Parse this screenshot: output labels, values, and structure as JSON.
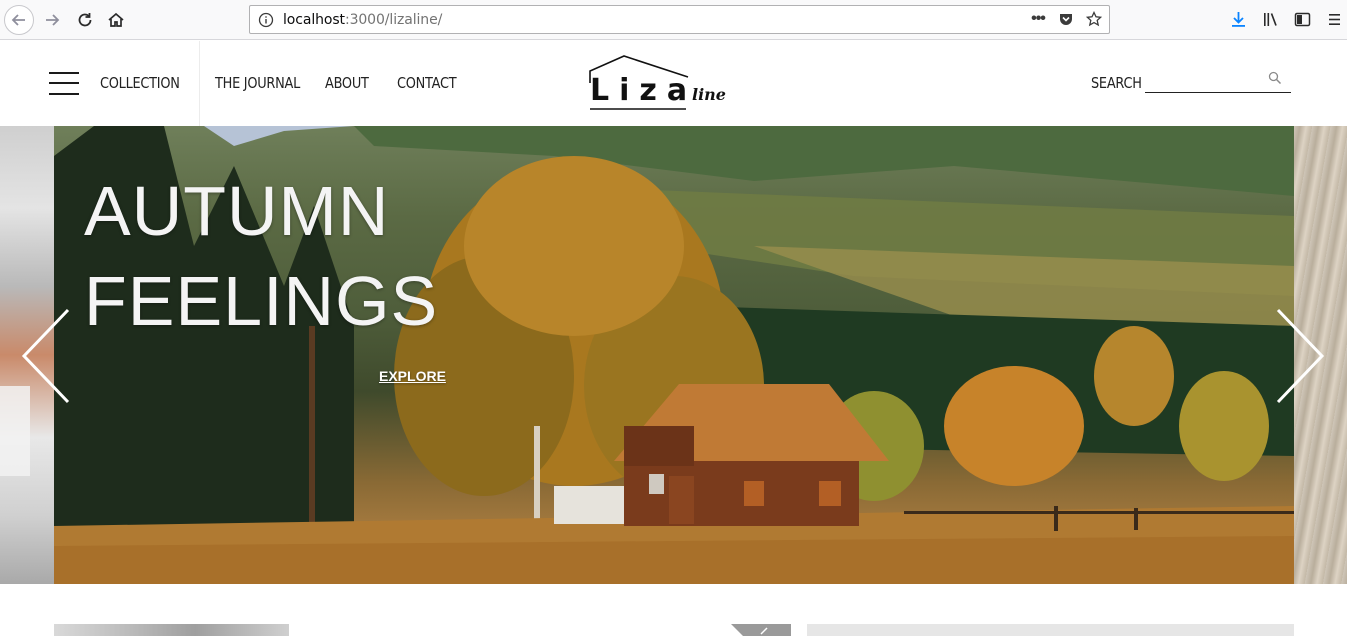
{
  "browser": {
    "url_host": "localhost",
    "url_rest": ":3000/lizaline/",
    "page_actions_label": "•••"
  },
  "header": {
    "nav": {
      "collection": "COLLECTION",
      "journal": "THE JOURNAL",
      "about": "ABOUT",
      "contact": "CONTACT"
    },
    "logo": {
      "main": "Liza",
      "sub": "line"
    },
    "search": {
      "label": "SEARCH",
      "value": "",
      "placeholder": ""
    }
  },
  "hero": {
    "title_line1": "AUTUMN",
    "title_line2": "FEELINGS",
    "cta": "EXPLORE"
  },
  "icons": {
    "back": "back-arrow-icon",
    "forward": "forward-arrow-icon",
    "reload": "reload-icon",
    "home": "home-icon",
    "info": "info-icon",
    "pocket": "pocket-icon",
    "bookmark": "star-icon",
    "download": "download-icon",
    "library": "library-icon",
    "sidebar": "sidebar-icon",
    "menu": "menu-icon",
    "search": "search-icon",
    "prev": "chevron-left-icon",
    "next": "chevron-right-icon"
  },
  "colors": {
    "download_accent": "#0a84ff",
    "text": "#222222",
    "hero_text": "#f4f4f4"
  }
}
